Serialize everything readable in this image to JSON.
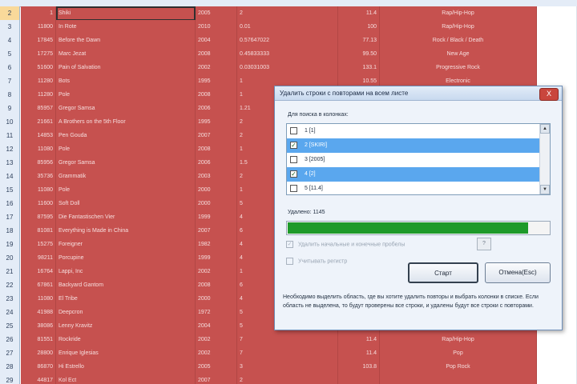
{
  "rows": [
    {
      "num": "2",
      "id": "1",
      "name": "Shiki",
      "year": "2005",
      "plays": "2",
      "val": "11.4",
      "genre": "Rap/Hip-Hop"
    },
    {
      "num": "3",
      "id": "11800",
      "name": "In Rote",
      "year": "2010",
      "plays": "0.01",
      "val": "100",
      "genre": "Rap/Hip-Hop"
    },
    {
      "num": "4",
      "id": "17845",
      "name": "Before the Dawn",
      "year": "2004",
      "plays": "0.57647022",
      "val": "77.13",
      "genre": "Rock / Black / Death"
    },
    {
      "num": "5",
      "id": "17275",
      "name": "Marc Jezat",
      "year": "2008",
      "plays": "0.45833333",
      "val": "99.50",
      "genre": "New Age"
    },
    {
      "num": "6",
      "id": "51600",
      "name": "Pain of Salvation",
      "year": "2002",
      "plays": "0.03031003",
      "val": "133.1",
      "genre": "Progressive Rock"
    },
    {
      "num": "7",
      "id": "11280",
      "name": "Bots",
      "year": "1995",
      "plays": "1",
      "val": "10.55",
      "genre": "Electronic"
    },
    {
      "num": "8",
      "id": "11280",
      "name": "Pole",
      "year": "2008",
      "plays": "1",
      "val": "",
      "genre": ""
    },
    {
      "num": "9",
      "id": "85957",
      "name": "Gregor Samsa",
      "year": "2006",
      "plays": "1.21",
      "val": "",
      "genre": ""
    },
    {
      "num": "10",
      "id": "21661",
      "name": "A Brothers on the 5th Floor",
      "year": "1995",
      "plays": "2",
      "val": "",
      "genre": ""
    },
    {
      "num": "11",
      "id": "14853",
      "name": "Pen Gouda",
      "year": "2007",
      "plays": "2",
      "val": "",
      "genre": ""
    },
    {
      "num": "12",
      "id": "11080",
      "name": "Pole",
      "year": "2008",
      "plays": "1",
      "val": "",
      "genre": ""
    },
    {
      "num": "13",
      "id": "85956",
      "name": "Gregor Samsa",
      "year": "2006",
      "plays": "1.5",
      "val": "",
      "genre": ""
    },
    {
      "num": "14",
      "id": "35736",
      "name": "Grammatik",
      "year": "2003",
      "plays": "2",
      "val": "",
      "genre": ""
    },
    {
      "num": "15",
      "id": "11080",
      "name": "Pole",
      "year": "2000",
      "plays": "1",
      "val": "",
      "genre": ""
    },
    {
      "num": "16",
      "id": "11600",
      "name": "Soft Doll",
      "year": "2000",
      "plays": "5",
      "val": "",
      "genre": ""
    },
    {
      "num": "17",
      "id": "87595",
      "name": "Die Fantastischen Vier",
      "year": "1999",
      "plays": "4",
      "val": "",
      "genre": ""
    },
    {
      "num": "18",
      "id": "81081",
      "name": "Everything is Made in China",
      "year": "2007",
      "plays": "6",
      "val": "",
      "genre": ""
    },
    {
      "num": "19",
      "id": "15275",
      "name": "Foreigner",
      "year": "1982",
      "plays": "4",
      "val": "",
      "genre": ""
    },
    {
      "num": "20",
      "id": "98211",
      "name": "Porcupine",
      "year": "1999",
      "plays": "4",
      "val": "",
      "genre": ""
    },
    {
      "num": "21",
      "id": "16764",
      "name": "Lappi, Inc",
      "year": "2002",
      "plays": "1",
      "val": "",
      "genre": ""
    },
    {
      "num": "22",
      "id": "67861",
      "name": "Backyard Gantom",
      "year": "2008",
      "plays": "6",
      "val": "",
      "genre": ""
    },
    {
      "num": "23",
      "id": "11080",
      "name": "El Tribe",
      "year": "2000",
      "plays": "4",
      "val": "",
      "genre": ""
    },
    {
      "num": "24",
      "id": "41988",
      "name": "Deepcron",
      "year": "1972",
      "plays": "5",
      "val": "",
      "genre": ""
    },
    {
      "num": "25",
      "id": "38086",
      "name": "Lenny Kravitz",
      "year": "2004",
      "plays": "5",
      "val": "",
      "genre": ""
    },
    {
      "num": "26",
      "id": "81551",
      "name": "Rockride",
      "year": "2002",
      "plays": "7",
      "val": "11.4",
      "genre": "Rap/Hip-Hop"
    },
    {
      "num": "27",
      "id": "28800",
      "name": "Enrique Iglesias",
      "year": "2002",
      "plays": "7",
      "val": "11.4",
      "genre": "Pop"
    },
    {
      "num": "28",
      "id": "86870",
      "name": "Hi Estrello",
      "year": "2005",
      "plays": "3",
      "val": "103.8",
      "genre": "Pop Rock"
    },
    {
      "num": "29",
      "id": "44817",
      "name": "Kol Ect",
      "year": "2007",
      "plays": "2",
      "val": "",
      "genre": ""
    }
  ],
  "dialog": {
    "title": "Удалить строки с повторами на всем листе",
    "close_label": "X",
    "columns_label": "Для поиска в колонках:",
    "items": [
      {
        "label": "1 [1]",
        "checked": false,
        "selected": false
      },
      {
        "label": "2 [SKIRI]",
        "checked": true,
        "selected": true
      },
      {
        "label": "3 [2005]",
        "checked": false,
        "selected": false
      },
      {
        "label": "4 [2]",
        "checked": true,
        "selected": true
      },
      {
        "label": "5 [11.4]",
        "checked": false,
        "selected": false
      }
    ],
    "progress_label": "Удалено: 1145",
    "progress_fraction": 0.92,
    "option1": "Удалить начальные и конечные пробелы",
    "option1_help": "?",
    "option2": "Учитывать регистр",
    "start_button": "Старт",
    "cancel_button": "Отмена(Esc)",
    "note": "Необходимо выделить область, где вы хотите удалить повторы и выбрать колонки в списке. Если область не выделена, то будут проверены все строки, и удалены будут все строки с повторами."
  },
  "colors": {
    "cell_fill": "#c6514f",
    "highlight": "#5aa7ee",
    "progress": "#1e9a2a"
  }
}
